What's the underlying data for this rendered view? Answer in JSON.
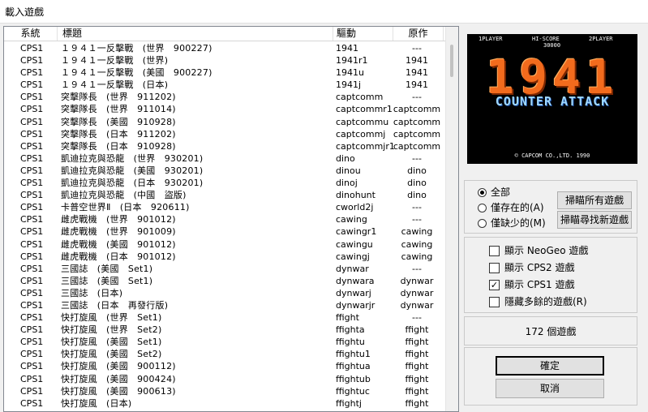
{
  "window": {
    "title": "載入遊戲"
  },
  "list": {
    "columns": {
      "system": "系統",
      "title": "標題",
      "driver": "驅動",
      "parent": "原作"
    },
    "rows": [
      {
        "system": "CPS1",
        "title": "１９４１一反擊戰　(世界　900227)",
        "driver": "1941",
        "parent": "---"
      },
      {
        "system": "CPS1",
        "title": "１９４１一反擊戰　(世界)",
        "driver": "1941r1",
        "parent": "1941"
      },
      {
        "system": "CPS1",
        "title": "１９４１一反擊戰　(美國　900227)",
        "driver": "1941u",
        "parent": "1941"
      },
      {
        "system": "CPS1",
        "title": "１９４１一反擊戰　(日本)",
        "driver": "1941j",
        "parent": "1941"
      },
      {
        "system": "CPS1",
        "title": "突擊隊長　(世界　911202)",
        "driver": "captcomm",
        "parent": "---"
      },
      {
        "system": "CPS1",
        "title": "突擊隊長　(世界　911014)",
        "driver": "captcommr1",
        "parent": "captcomm"
      },
      {
        "system": "CPS1",
        "title": "突擊隊長　(美國　910928)",
        "driver": "captcommu",
        "parent": "captcomm"
      },
      {
        "system": "CPS1",
        "title": "突擊隊長　(日本　911202)",
        "driver": "captcommj",
        "parent": "captcomm"
      },
      {
        "system": "CPS1",
        "title": "突擊隊長　(日本　910928)",
        "driver": "captcommjr1",
        "parent": "captcomm"
      },
      {
        "system": "CPS1",
        "title": "凱迪拉克與恐龍　(世界　930201)",
        "driver": "dino",
        "parent": "---"
      },
      {
        "system": "CPS1",
        "title": "凱迪拉克與恐龍　(美國　930201)",
        "driver": "dinou",
        "parent": "dino"
      },
      {
        "system": "CPS1",
        "title": "凱迪拉克與恐龍　(日本　930201)",
        "driver": "dinoj",
        "parent": "dino"
      },
      {
        "system": "CPS1",
        "title": "凱迪拉克與恐龍　(中國　盜版)",
        "driver": "dinohunt",
        "parent": "dino"
      },
      {
        "system": "CPS1",
        "title": "卡普空世界Ⅱ　(日本　920611)",
        "driver": "cworld2j",
        "parent": "---"
      },
      {
        "system": "CPS1",
        "title": "雌虎戰機　(世界　901012)",
        "driver": "cawing",
        "parent": "---"
      },
      {
        "system": "CPS1",
        "title": "雌虎戰機　(世界　901009)",
        "driver": "cawingr1",
        "parent": "cawing"
      },
      {
        "system": "CPS1",
        "title": "雌虎戰機　(美國　901012)",
        "driver": "cawingu",
        "parent": "cawing"
      },
      {
        "system": "CPS1",
        "title": "雌虎戰機　(日本　901012)",
        "driver": "cawingj",
        "parent": "cawing"
      },
      {
        "system": "CPS1",
        "title": "三國誌　(美國　Set1)",
        "driver": "dynwar",
        "parent": "---"
      },
      {
        "system": "CPS1",
        "title": "三國誌　(美國　Set1)",
        "driver": "dynwara",
        "parent": "dynwar"
      },
      {
        "system": "CPS1",
        "title": "三國誌　(日本)",
        "driver": "dynwarj",
        "parent": "dynwar"
      },
      {
        "system": "CPS1",
        "title": "三國誌　(日本　再發行版)",
        "driver": "dynwarjr",
        "parent": "dynwar"
      },
      {
        "system": "CPS1",
        "title": "快打旋風　(世界　Set1)",
        "driver": "ffight",
        "parent": "---"
      },
      {
        "system": "CPS1",
        "title": "快打旋風　(世界　Set2)",
        "driver": "ffighta",
        "parent": "ffight"
      },
      {
        "system": "CPS1",
        "title": "快打旋風　(美國　Set1)",
        "driver": "ffightu",
        "parent": "ffight"
      },
      {
        "system": "CPS1",
        "title": "快打旋風　(美國　Set2)",
        "driver": "ffightu1",
        "parent": "ffight"
      },
      {
        "system": "CPS1",
        "title": "快打旋風　(美國　900112)",
        "driver": "ffightua",
        "parent": "ffight"
      },
      {
        "system": "CPS1",
        "title": "快打旋風　(美國　900424)",
        "driver": "ffightub",
        "parent": "ffight"
      },
      {
        "system": "CPS1",
        "title": "快打旋風　(美國　900613)",
        "driver": "ffightuc",
        "parent": "ffight"
      },
      {
        "system": "CPS1",
        "title": "快打旋風　(日本)",
        "driver": "ffightj",
        "parent": "ffight"
      }
    ]
  },
  "preview": {
    "hud_left": "1PLAYER",
    "hud_center": "HI-SCORE",
    "hud_right": "2PLAYER",
    "hud_score": "30000",
    "logo": "1941",
    "subtitle": "COUNTER ATTACK",
    "copyright": "© CAPCOM CO.,LTD. 1990"
  },
  "filter": {
    "all": "全部",
    "existing": "僅存在的(A)",
    "missing": "僅缺少的(M)",
    "selected": "all",
    "scan_all": "掃瞄所有遊戲",
    "scan_new": "掃瞄尋找新遊戲"
  },
  "options": {
    "neogeo": "顯示 NeoGeo 遊戲",
    "cps2": "顯示 CPS2 遊戲",
    "cps1": "顯示 CPS1 遊戲",
    "hide_clones": "隱藏多餘的遊戲(R)",
    "checked": [
      "cps1"
    ]
  },
  "status": {
    "count": "172 個遊戲"
  },
  "actions": {
    "ok": "確定",
    "cancel": "取消"
  },
  "colors": {
    "window_bg": "#f0f0f0",
    "logo_orange": "#f26b1d",
    "subtitle_blue": "#9fd8ff"
  }
}
